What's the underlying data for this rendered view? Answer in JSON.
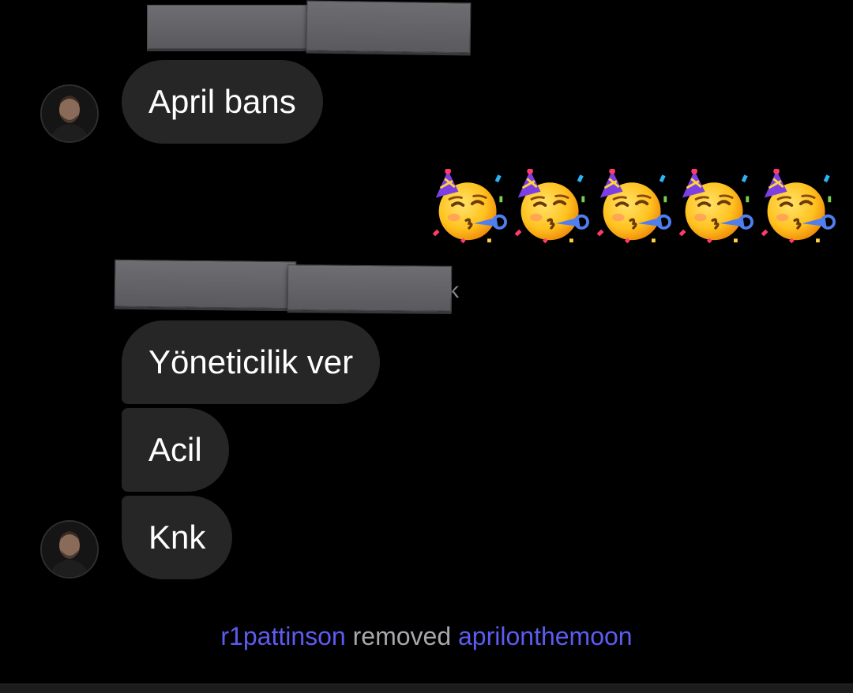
{
  "thread": {
    "sender_fragment_1": "k",
    "messages": [
      {
        "text": "April bans"
      },
      {
        "text": "Yöneticilik ver"
      },
      {
        "text": "Acil"
      },
      {
        "text": "Knk"
      }
    ],
    "reaction": {
      "emoji": "partying-face",
      "count": 5
    },
    "system": {
      "actor": "r1pattinson",
      "action": "removed",
      "target": "aprilonthemoon"
    }
  },
  "colors": {
    "background": "#000000",
    "bubble": "#262626",
    "username_link": "#5b5cf0",
    "system_text": "#a8a8ad"
  }
}
